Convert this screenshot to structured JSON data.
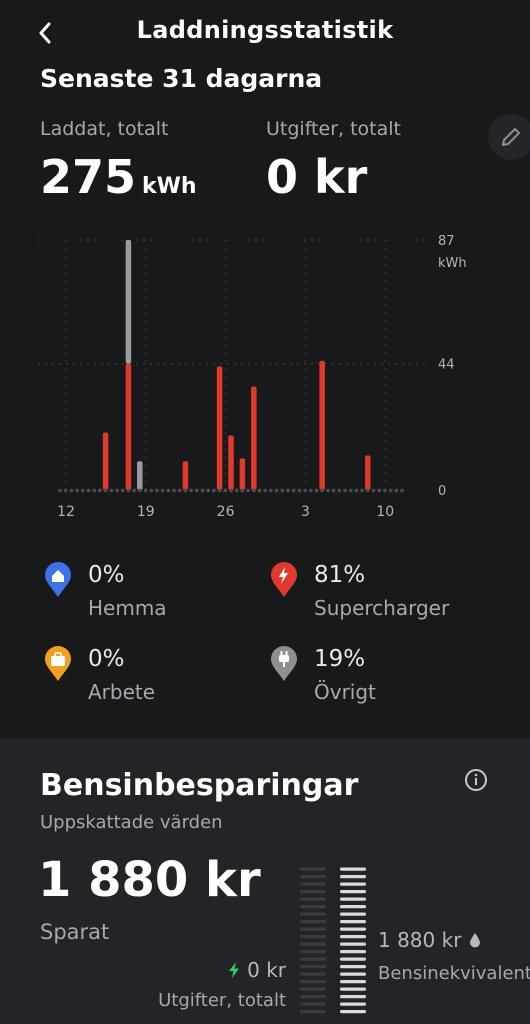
{
  "header": {
    "title": "Laddningsstatistik"
  },
  "period": "Senaste 31 dagarna",
  "totals": {
    "charged_label": "Laddat, totalt",
    "charged_value": "275",
    "charged_unit": "kWh",
    "cost_label": "Utgifter, totalt",
    "cost_value": "0 kr"
  },
  "chart_data": {
    "type": "bar",
    "x_tick_labels": [
      "12",
      "19",
      "26",
      "3",
      "10"
    ],
    "y_tick_labels": [
      "87",
      "44",
      "0"
    ],
    "y_unit": "kWh",
    "ylim": [
      0,
      87
    ],
    "grid": true,
    "categories": [
      "12",
      "13",
      "14",
      "15",
      "16",
      "17",
      "18",
      "19",
      "20",
      "21",
      "22",
      "23",
      "24",
      "25",
      "26",
      "27",
      "28",
      "29",
      "30",
      "31",
      "1",
      "2",
      "3",
      "4",
      "5",
      "6",
      "7",
      "8",
      "9",
      "10",
      "11"
    ],
    "series": [
      {
        "name": "Supercharger",
        "color": "#e03a2e",
        "values": [
          0,
          0,
          0,
          0,
          20,
          0,
          44,
          0,
          0,
          0,
          0,
          10,
          0,
          0,
          43,
          19,
          11,
          36,
          0,
          0,
          0,
          0,
          0,
          45,
          0,
          0,
          0,
          12,
          0,
          0,
          0
        ]
      },
      {
        "name": "Övrigt",
        "color": "#9a9b9f",
        "values": [
          0,
          0,
          0,
          0,
          0,
          0,
          43,
          10,
          0,
          0,
          0,
          0,
          0,
          0,
          0,
          0,
          0,
          0,
          0,
          0,
          0,
          0,
          0,
          0,
          0,
          0,
          0,
          0,
          0,
          0,
          0
        ]
      }
    ]
  },
  "legend": [
    {
      "pct": "0%",
      "name": "Hemma",
      "color": "#3f72e6",
      "icon": "home-icon"
    },
    {
      "pct": "81%",
      "name": "Supercharger",
      "color": "#e03a2e",
      "icon": "lightning-icon"
    },
    {
      "pct": "0%",
      "name": "Arbete",
      "color": "#f0a020",
      "icon": "briefcase-icon"
    },
    {
      "pct": "19%",
      "name": "Övrigt",
      "color": "#8e8f93",
      "icon": "plug-icon"
    }
  ],
  "savings": {
    "title": "Bensinbesparingar",
    "subtitle": "Uppskattade värden",
    "saved_value": "1 880 kr",
    "saved_label": "Sparat",
    "cost_value": "0 kr",
    "cost_label": "Utgifter, totalt",
    "cost_level": 0,
    "fuel_value": "1 880 kr",
    "fuel_label": "Bensinekvivalent",
    "fuel_level": 1
  }
}
